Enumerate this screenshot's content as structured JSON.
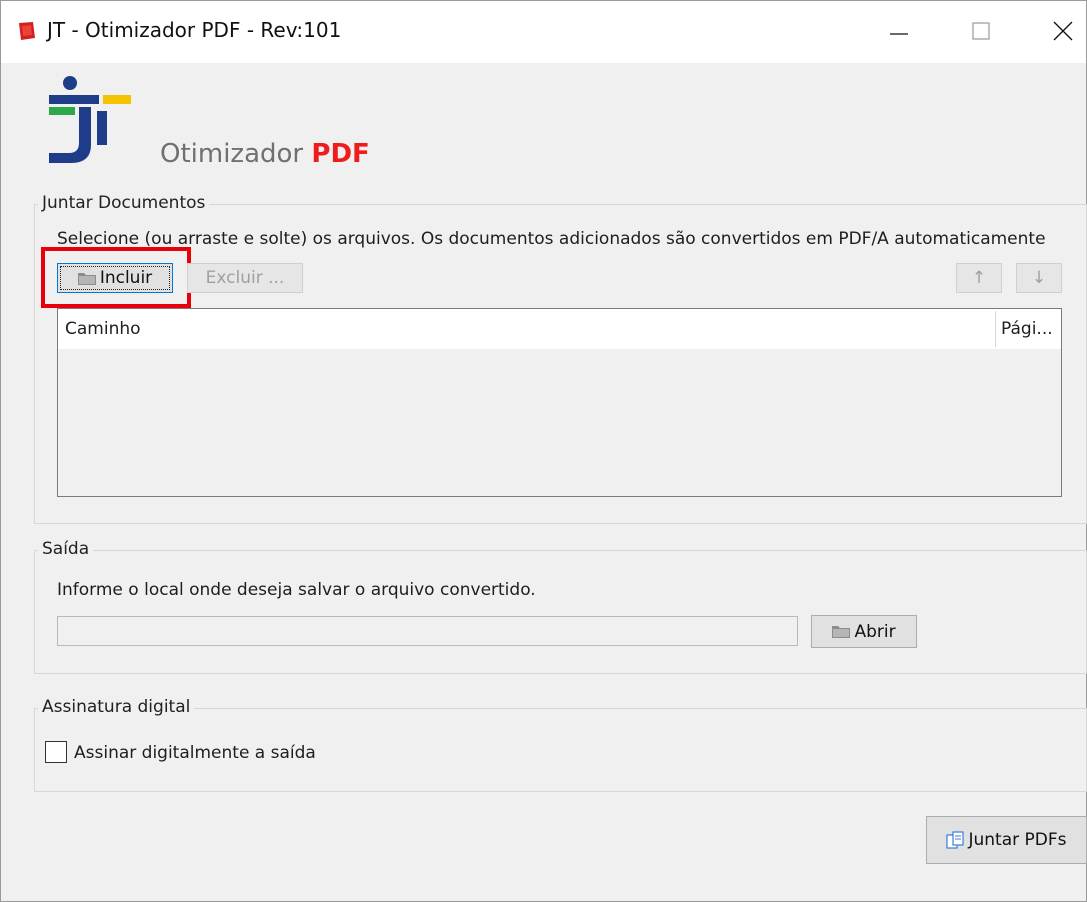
{
  "window": {
    "title": "JT - Otimizador PDF - Rev:101"
  },
  "branding": {
    "product_prefix": "Otimizador",
    "product_suffix": "PDF"
  },
  "juntar": {
    "legend": "Juntar Documentos",
    "instructions": "Selecione (ou arraste e solte) os arquivos. Os documentos adicionados são convertidos em PDF/A automaticamente",
    "include_label": "Incluir",
    "exclude_label": "Excluir ...",
    "up_label": "↑",
    "down_label": "↓",
    "table": {
      "columns": [
        "Caminho",
        "Pági..."
      ],
      "rows": []
    }
  },
  "saida": {
    "legend": "Saída",
    "instructions": "Informe o local onde deseja salvar o arquivo convertido.",
    "path_value": "",
    "open_label": "Abrir"
  },
  "assinatura": {
    "legend": "Assinatura digital",
    "checkbox_label": "Assinar digitalmente a saída",
    "checked": false
  },
  "actions": {
    "merge_label": "Juntar PDFs"
  },
  "colors": {
    "highlight": "#e8000a",
    "pdf_red": "#ee1c1c",
    "logo_blue": "#1f3c88",
    "logo_green": "#2aa84a",
    "logo_yellow": "#f5c400"
  }
}
